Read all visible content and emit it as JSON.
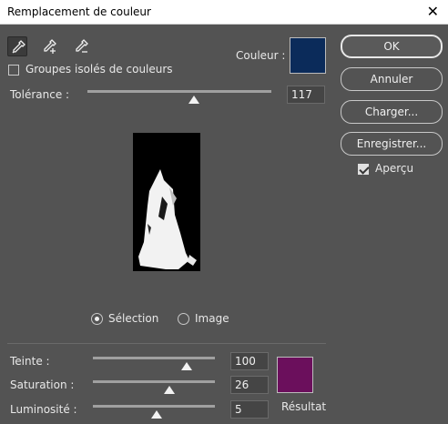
{
  "window": {
    "title": "Remplacement de couleur",
    "close_symbol": "✕"
  },
  "tools": [
    {
      "name": "eyedropper-icon",
      "active": true
    },
    {
      "name": "eyedropper-plus-icon",
      "active": false
    },
    {
      "name": "eyedropper-minus-icon",
      "active": false
    }
  ],
  "groups_checkbox": {
    "label": "Groupes isolés de couleurs",
    "checked": false
  },
  "couleur": {
    "label": "Couleur :",
    "color": "#0b2b5a"
  },
  "tolerance": {
    "label": "Tolérance :",
    "value": "117",
    "slider_fraction": 0.58
  },
  "view_mode": {
    "selection_label": "Sélection",
    "image_label": "Image",
    "selected": "selection"
  },
  "teinte": {
    "label": "Teinte :",
    "value": "100",
    "slider_fraction": 0.77
  },
  "saturation": {
    "label": "Saturation :",
    "value": "26",
    "slider_fraction": 0.63
  },
  "luminosite": {
    "label": "Luminosité :",
    "value": "5",
    "slider_fraction": 0.52
  },
  "resultat": {
    "label": "Résultat",
    "color": "#6b0f5c"
  },
  "buttons": {
    "ok": "OK",
    "annuler": "Annuler",
    "charger": "Charger...",
    "enregistrer": "Enregistrer..."
  },
  "apercu": {
    "label": "Aperçu",
    "checked": true
  }
}
